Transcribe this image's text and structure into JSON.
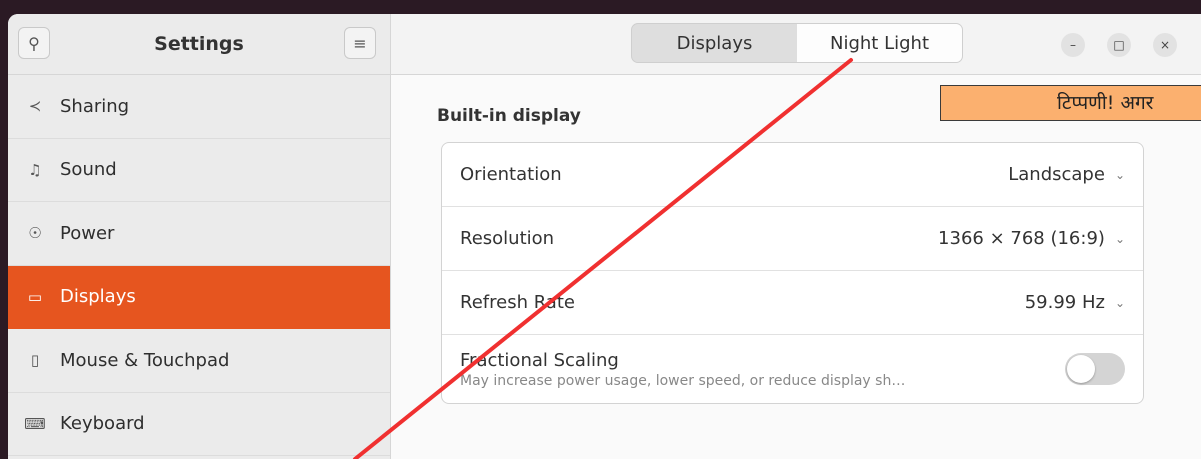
{
  "sidebar": {
    "title": "Settings",
    "items": [
      {
        "label": "Sharing",
        "icon": "share-icon",
        "glyph": "⟨"
      },
      {
        "label": "Sound",
        "icon": "music-note-icon",
        "glyph": "♫"
      },
      {
        "label": "Power",
        "icon": "power-icon",
        "glyph": "◔"
      },
      {
        "label": "Displays",
        "icon": "display-icon",
        "glyph": "▭"
      },
      {
        "label": "Mouse & Touchpad",
        "icon": "mouse-icon",
        "glyph": "▯"
      },
      {
        "label": "Keyboard",
        "icon": "keyboard-icon",
        "glyph": "⌨"
      }
    ]
  },
  "header": {
    "tabs": [
      "Displays",
      "Night Light"
    ],
    "selected_tab": "Night Light"
  },
  "main": {
    "section_title": "Built-in display",
    "note": "टिप्पणी! अगर",
    "rows": [
      {
        "label": "Orientation",
        "value": "Landscape"
      },
      {
        "label": "Resolution",
        "value": "1366 × 768 (16:9)"
      },
      {
        "label": "Refresh Rate",
        "value": "59.99 Hz"
      }
    ],
    "fractional": {
      "label": "Fractional Scaling",
      "description": "May increase power usage, lower speed, or reduce display sh…",
      "enabled": false
    }
  },
  "colors": {
    "accent": "#e6551f",
    "annotation_line": "#f03030",
    "note_bg": "#fbb06f"
  }
}
